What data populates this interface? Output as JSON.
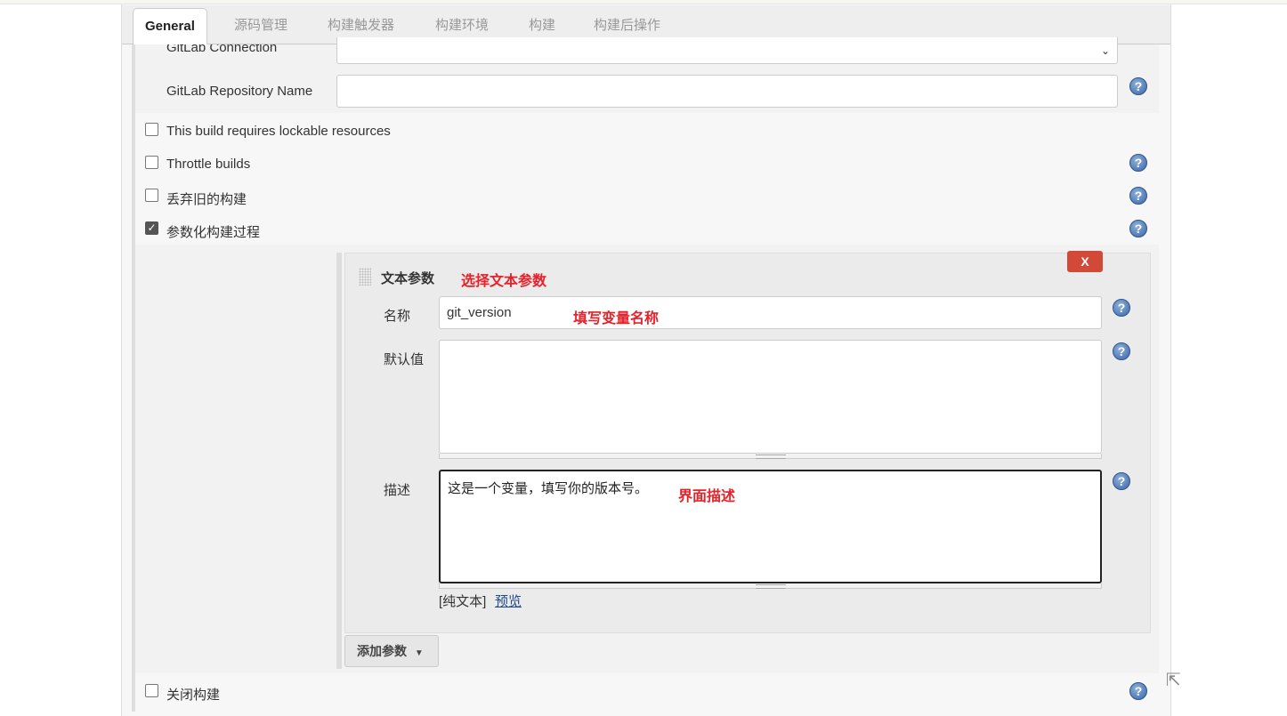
{
  "tabs": [
    {
      "label": "General",
      "active": true
    },
    {
      "label": "源码管理"
    },
    {
      "label": "构建触发器"
    },
    {
      "label": "构建环境"
    },
    {
      "label": "构建"
    },
    {
      "label": "构建后操作"
    }
  ],
  "gitlab": {
    "connection_label": "GitLab Connection",
    "connection_value": "",
    "repo_label": "GitLab Repository Name",
    "repo_value": ""
  },
  "options": [
    {
      "label": "This build requires lockable resources",
      "checked": false
    },
    {
      "label": "Throttle builds",
      "checked": false
    },
    {
      "label": "丢弃旧的构建",
      "checked": false
    },
    {
      "label": "参数化构建过程",
      "checked": true
    }
  ],
  "param": {
    "title": "文本参数",
    "delete_label": "X",
    "name_label": "名称",
    "name_value": "git_version",
    "default_label": "默认值",
    "default_value": "",
    "desc_label": "描述",
    "desc_value": "这是一个变量，填写你的版本号。",
    "format_text": "[纯文本]",
    "preview_link": "预览"
  },
  "annotations": {
    "choose": "选择文本参数",
    "name": "填写变量名称",
    "desc": "界面描述"
  },
  "add_param_label": "添加参数",
  "disable_build": {
    "label": "关闭构建",
    "checked": false
  },
  "help_glyph": "?",
  "colors": {
    "annotation": "#e8202a",
    "delete": "#d24939",
    "link": "#204a87"
  }
}
